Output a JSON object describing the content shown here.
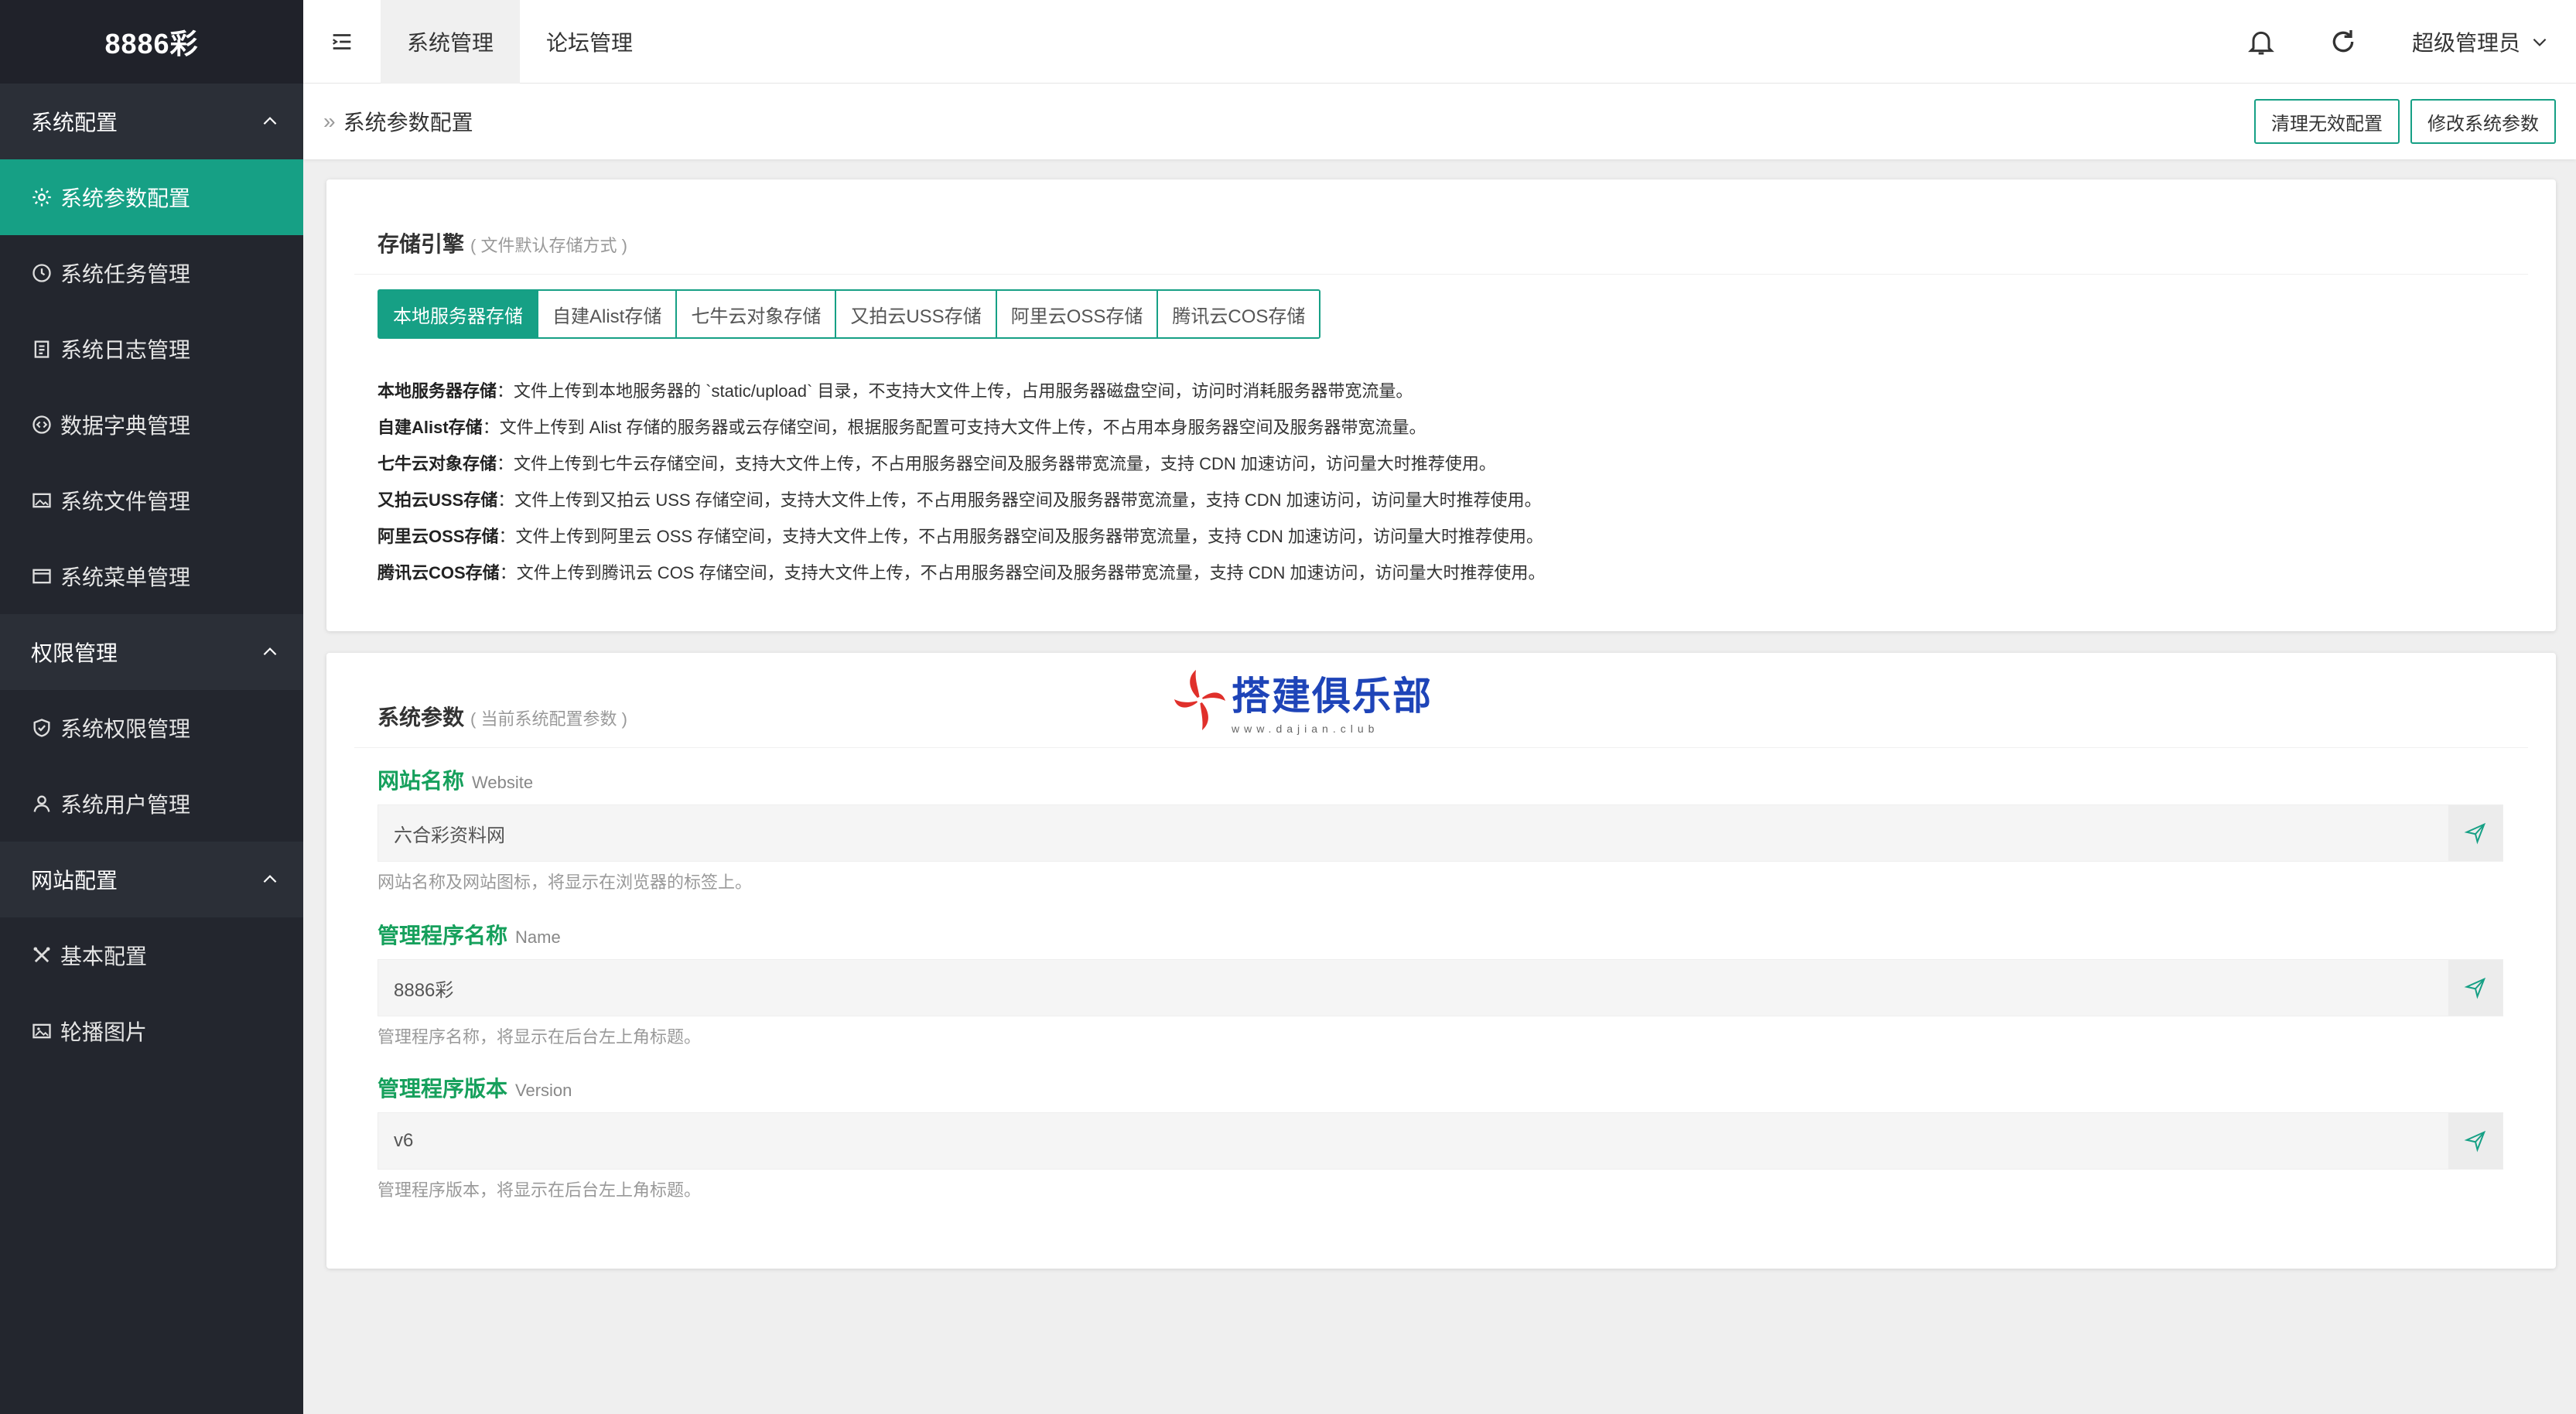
{
  "app": {
    "logo": "8886彩"
  },
  "sidebar": {
    "groups": [
      {
        "title": "系统配置",
        "items": [
          {
            "label": "系统参数配置",
            "icon": "gear-icon",
            "active": true
          },
          {
            "label": "系统任务管理",
            "icon": "clock-icon"
          },
          {
            "label": "系统日志管理",
            "icon": "clipboard-icon"
          },
          {
            "label": "数据字典管理",
            "icon": "code-icon"
          },
          {
            "label": "系统文件管理",
            "icon": "image-file-icon"
          },
          {
            "label": "系统菜单管理",
            "icon": "window-icon"
          }
        ]
      },
      {
        "title": "权限管理",
        "items": [
          {
            "label": "系统权限管理",
            "icon": "shield-check-icon"
          },
          {
            "label": "系统用户管理",
            "icon": "user-icon"
          }
        ]
      },
      {
        "title": "网站配置",
        "items": [
          {
            "label": "基本配置",
            "icon": "tools-icon"
          },
          {
            "label": "轮播图片",
            "icon": "picture-icon"
          }
        ]
      }
    ]
  },
  "topbar": {
    "tabs": [
      {
        "label": "系统管理",
        "active": true
      },
      {
        "label": "论坛管理"
      }
    ],
    "user": "超级管理员"
  },
  "breadcrumb": {
    "sep": "»",
    "current": "系统参数配置",
    "actions": {
      "clear": "清理无效配置",
      "edit": "修改系统参数"
    }
  },
  "storage": {
    "title": "存储引擎",
    "subtitle": "( 文件默认存储方式 )",
    "options": [
      "本地服务器存储",
      "自建Alist存储",
      "七牛云对象存储",
      "又拍云USS存储",
      "阿里云OSS存储",
      "腾讯云COS存储"
    ],
    "descriptions": [
      {
        "name": "本地服务器存储",
        "text": "：文件上传到本地服务器的 `static/upload` 目录，不支持大文件上传，占用服务器磁盘空间，访问时消耗服务器带宽流量。"
      },
      {
        "name": "自建Alist存储",
        "text": "：文件上传到 Alist 存储的服务器或云存储空间，根据服务配置可支持大文件上传，不占用本身服务器空间及服务器带宽流量。"
      },
      {
        "name": "七牛云对象存储",
        "text": "：文件上传到七牛云存储空间，支持大文件上传，不占用服务器空间及服务器带宽流量，支持 CDN 加速访问，访问量大时推荐使用。"
      },
      {
        "name": "又拍云USS存储",
        "text": "：文件上传到又拍云 USS 存储空间，支持大文件上传，不占用服务器空间及服务器带宽流量，支持 CDN 加速访问，访问量大时推荐使用。"
      },
      {
        "name": "阿里云OSS存储",
        "text": "：文件上传到阿里云 OSS 存储空间，支持大文件上传，不占用服务器空间及服务器带宽流量，支持 CDN 加速访问，访问量大时推荐使用。"
      },
      {
        "name": "腾讯云COS存储",
        "text": "：文件上传到腾讯云 COS 存储空间，支持大文件上传，不占用服务器空间及服务器带宽流量，支持 CDN 加速访问，访问量大时推荐使用。"
      }
    ]
  },
  "params": {
    "title": "系统参数",
    "subtitle": "( 当前系统配置参数 )",
    "fields": [
      {
        "label": "网站名称",
        "en": "Website",
        "value": "六合彩资料网",
        "help": "网站名称及网站图标，将显示在浏览器的标签上。"
      },
      {
        "label": "管理程序名称",
        "en": "Name",
        "value": "8886彩",
        "help": "管理程序名称，将显示在后台左上角标题。"
      },
      {
        "label": "管理程序版本",
        "en": "Version",
        "value": "v6",
        "help": "管理程序版本，将显示在后台左上角标题。"
      }
    ]
  },
  "watermark": {
    "main": "搭建俱乐部",
    "sub": "www.dajian.club"
  },
  "colors": {
    "accent": "#16a085",
    "sidebar": "#23262e",
    "label_green": "#16a05c"
  }
}
